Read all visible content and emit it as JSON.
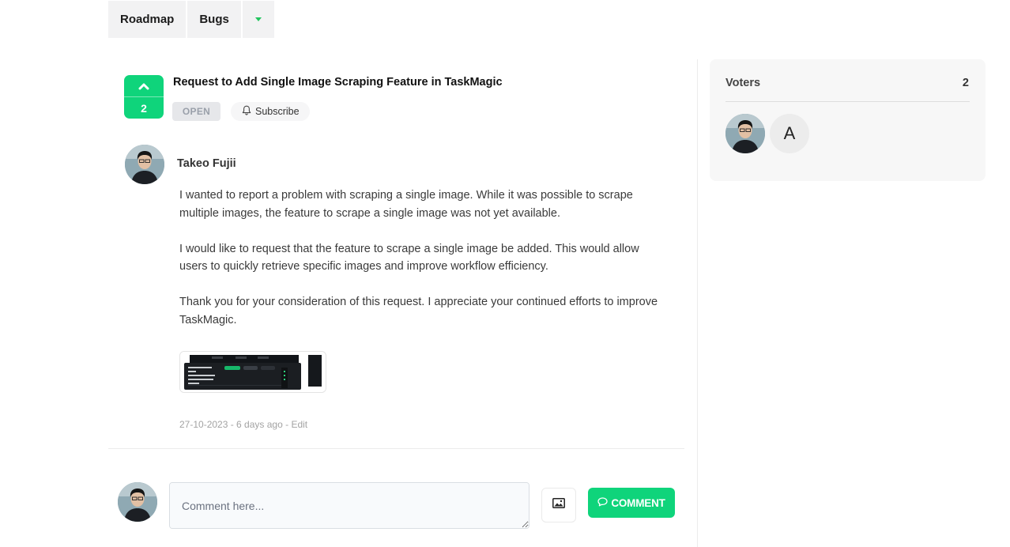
{
  "nav": {
    "items": [
      {
        "label": "Roadmap"
      },
      {
        "label": "Bugs"
      }
    ],
    "more_icon": "caret-down-icon",
    "accent": "#22c55e"
  },
  "post": {
    "votes": "2",
    "title": "Request to Add Single Image Scraping Feature in TaskMagic",
    "status": "OPEN",
    "subscribe_label": "Subscribe",
    "author": "Takeo Fujii",
    "paragraphs": [
      "I wanted to report a problem with scraping a single image. While it was possible to scrape multiple images, the feature to scrape a single image was not yet available.",
      "I would like to request that the feature to scrape a single image be added. This would allow users to quickly retrieve specific images and improve workflow efficiency.",
      "Thank you for your consideration of this request. I appreciate your continued efforts to improve TaskMagic."
    ],
    "date": "27-10-2023 - 6 days ago",
    "edit_label": "Edit"
  },
  "comment": {
    "placeholder": "Comment here...",
    "button_label": "COMMENT"
  },
  "voters": {
    "title": "Voters",
    "count": "2",
    "second_initial": "A"
  },
  "colors": {
    "brand_green": "#0fd47b"
  }
}
